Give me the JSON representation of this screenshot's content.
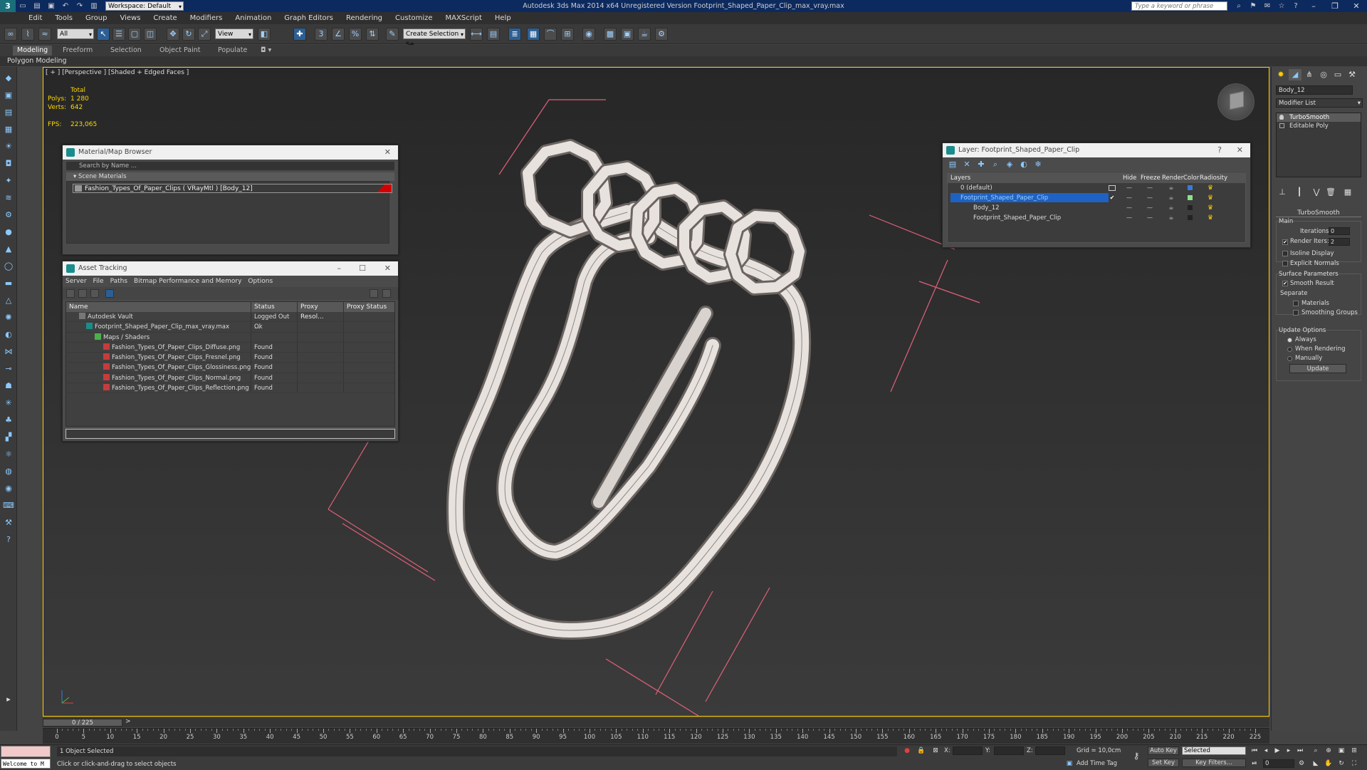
{
  "titlebar": {
    "workspace": "Workspace: Default",
    "title": "Autodesk 3ds Max 2014 x64    Unregistered Version    Footprint_Shaped_Paper_Clip_max_vray.max",
    "search_placeholder": "Type a keyword or phrase"
  },
  "menu": [
    "Edit",
    "Tools",
    "Group",
    "Views",
    "Create",
    "Modifiers",
    "Animation",
    "Graph Editors",
    "Rendering",
    "Customize",
    "MAXScript",
    "Help"
  ],
  "toolbar": {
    "filter": "All",
    "refcoord": "View",
    "selection_set": "Create Selection Se"
  },
  "ribbon": {
    "tabs": [
      "Modeling",
      "Freeform",
      "Selection",
      "Object Paint",
      "Populate"
    ],
    "sub": "Polygon Modeling"
  },
  "viewport": {
    "label": "[ + ] [Perspective ] [Shaded + Edged Faces ]",
    "stats_header": "Total",
    "polys_label": "Polys:",
    "polys": "1 280",
    "verts_label": "Verts:",
    "verts": "642",
    "fps_label": "FPS:",
    "fps": "223,065"
  },
  "material_browser": {
    "title": "Material/Map Browser",
    "search": "Search by Name ...",
    "section": "Scene Materials",
    "item": "Fashion_Types_Of_Paper_Clips ( VRayMtl ) [Body_12]"
  },
  "asset_tracking": {
    "title": "Asset Tracking",
    "menu": [
      "Server",
      "File",
      "Paths",
      "Bitmap Performance and Memory",
      "Options"
    ],
    "columns": [
      "Name",
      "Status",
      "Proxy Resol...",
      "Proxy Status"
    ],
    "rows": [
      {
        "name": "Autodesk Vault",
        "status": "Logged Out ...",
        "indent": 1
      },
      {
        "name": "Footprint_Shaped_Paper_Clip_max_vray.max",
        "status": "Ok",
        "indent": 2
      },
      {
        "name": "Maps / Shaders",
        "status": "",
        "indent": 3
      },
      {
        "name": "Fashion_Types_Of_Paper_Clips_Diffuse.png",
        "status": "Found",
        "indent": 4
      },
      {
        "name": "Fashion_Types_Of_Paper_Clips_Fresnel.png",
        "status": "Found",
        "indent": 4
      },
      {
        "name": "Fashion_Types_Of_Paper_Clips_Glossiness.png",
        "status": "Found",
        "indent": 4
      },
      {
        "name": "Fashion_Types_Of_Paper_Clips_Normal.png",
        "status": "Found",
        "indent": 4
      },
      {
        "name": "Fashion_Types_Of_Paper_Clips_Reflection.png",
        "status": "Found",
        "indent": 4
      }
    ]
  },
  "layer_window": {
    "title": "Layer: Footprint_Shaped_Paper_Clip",
    "columns": [
      "Layers",
      "Hide",
      "Freeze",
      "Render",
      "Color",
      "Radiosity"
    ],
    "rows": [
      {
        "name": "0 (default)",
        "color": "#3a7bd5",
        "indent": 1,
        "selected": false
      },
      {
        "name": "Footprint_Shaped_Paper_Clip",
        "color": "#8ee08e",
        "indent": 1,
        "selected": true
      },
      {
        "name": "Body_12",
        "color": "#222222",
        "indent": 2,
        "selected": false
      },
      {
        "name": "Footprint_Shaped_Paper_Clip",
        "color": "#222222",
        "indent": 2,
        "selected": false
      }
    ]
  },
  "command_panel": {
    "object_name": "Body_12",
    "modifier_list": "Modifier List",
    "stack": [
      "TurboSmooth",
      "Editable Poly"
    ],
    "rollout_title": "TurboSmooth",
    "main_label": "Main",
    "iterations_label": "Iterations:",
    "iterations": "0",
    "render_iters_label": "Render Iters:",
    "render_iters": "2",
    "isoline": "Isoline Display",
    "explicit": "Explicit Normals",
    "surface_params": "Surface Parameters",
    "smooth_result": "Smooth Result",
    "separate": "Separate",
    "materials": "Materials",
    "smoothing_groups": "Smoothing Groups",
    "update_options": "Update Options",
    "always": "Always",
    "when_rendering": "When Rendering",
    "manually": "Manually",
    "update_btn": "Update"
  },
  "timeline": {
    "frame": "0 / 225",
    "ticks": [
      0,
      5,
      10,
      15,
      20,
      25,
      30,
      35,
      40,
      45,
      50,
      55,
      60,
      65,
      70,
      75,
      80,
      85,
      90,
      95,
      100,
      105,
      110,
      115,
      120,
      125,
      130,
      135,
      140,
      145,
      150,
      155,
      160,
      165,
      170,
      175,
      180,
      185,
      190,
      195,
      200,
      205,
      210,
      215,
      220,
      225
    ]
  },
  "status": {
    "maxscript": "Welcome to M",
    "selected": "1 Object Selected",
    "prompt": "Click or click-and-drag to select objects",
    "x_label": "X:",
    "y_label": "Y:",
    "z_label": "Z:",
    "grid": "Grid = 10,0cm",
    "add_time_tag": "Add Time Tag",
    "auto_key": "Auto Key",
    "auto_key_sel": "Selected",
    "set_key": "Set Key",
    "key_filters": "Key Filters...",
    "frame_field": "0"
  },
  "colors": {
    "title_bg": "#0d2a5f",
    "viewport_border": "#ffd000",
    "stats_text": "#ffd800",
    "selection_blue": "#1e62c4",
    "gizmo_pink": "#e0607a"
  }
}
